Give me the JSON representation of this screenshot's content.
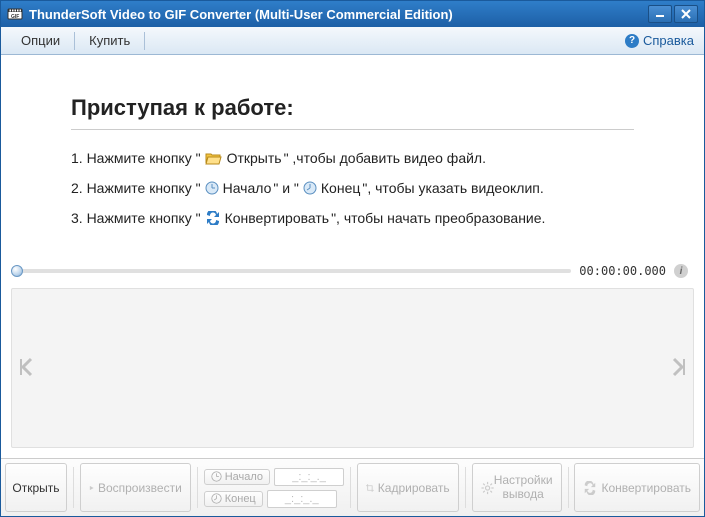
{
  "titlebar": {
    "title": "ThunderSoft Video to GIF Converter (Multi-User Commercial Edition)"
  },
  "menubar": {
    "options": "Опции",
    "buy": "Купить",
    "help": "Справка"
  },
  "guide": {
    "title": "Приступая к работе:",
    "step1_a": "1. Нажмите кнопку \" ",
    "step1_btn": "Открыть",
    "step1_b": "\" ,чтобы добавить видео файл.",
    "step2_a": "2. Нажмите кнопку \" ",
    "step2_btn1": "Начало",
    "step2_mid": " \" и \" ",
    "step2_btn2": "Конец",
    "step2_b": " \", чтобы указать видеоклип.",
    "step3_a": "3. Нажмите кнопку \" ",
    "step3_btn": "Конвертировать",
    "step3_b": " \", чтобы начать преобразование."
  },
  "player": {
    "timecode": "00:00:00.000"
  },
  "bottombar": {
    "open": "Открыть",
    "play": "Воспроизвести",
    "start": "Начало",
    "end": "Конец",
    "start_time": "_:_:_._",
    "end_time": "_:_:_._",
    "crop": "Кадрировать",
    "output_line1": "Настройки",
    "output_line2": "вывода",
    "convert": "Конвертировать"
  }
}
